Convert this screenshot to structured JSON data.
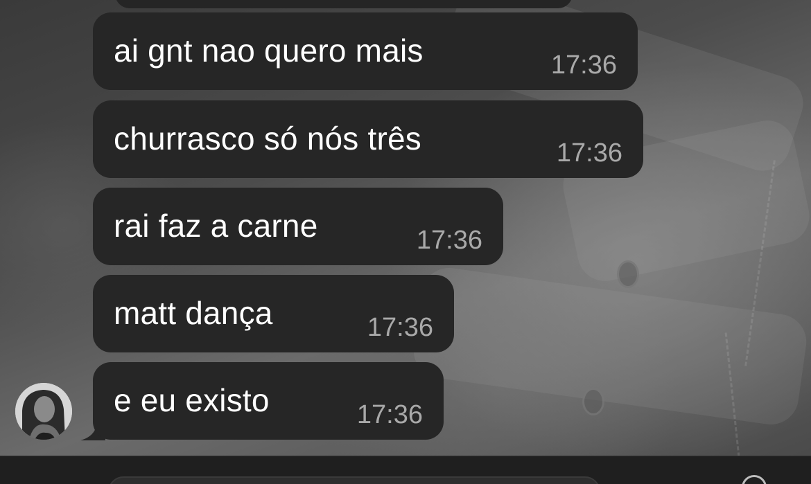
{
  "chat": {
    "messages": [
      {
        "text": "ai gnt nao quero mais",
        "time": "17:36"
      },
      {
        "text": "churrasco só nós três",
        "time": "17:36"
      },
      {
        "text": "rai faz a carne",
        "time": "17:36"
      },
      {
        "text": "matt dança",
        "time": "17:36"
      },
      {
        "text": "e eu existo",
        "time": "17:36"
      }
    ],
    "sender_avatar": "avatar-photo"
  },
  "colors": {
    "bubble_background": "#262626",
    "message_text": "#ffffff",
    "timestamp_text": "#a9a9a9",
    "input_bar_background": "#1f1f1f"
  },
  "icons": {
    "input_right": "circle-icon"
  }
}
